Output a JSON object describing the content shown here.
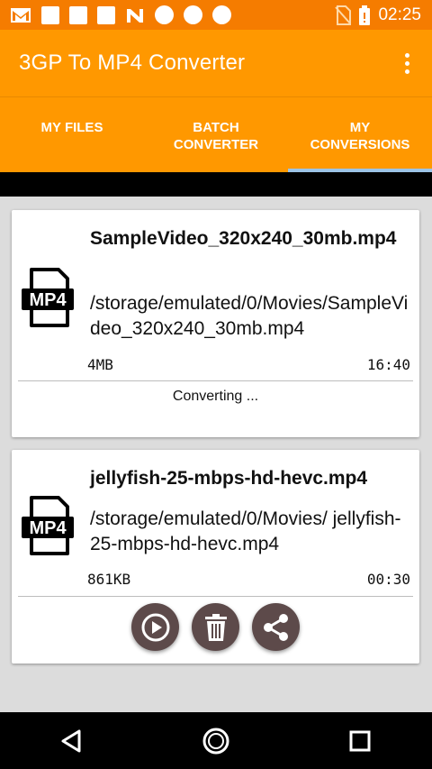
{
  "status_bar": {
    "time": "02:25",
    "icons": [
      "gmail-icon",
      "notification-icon",
      "notification-icon",
      "notification-icon",
      "nfc-icon",
      "circle-icon",
      "circle-icon",
      "circle-icon",
      "no-sim-icon",
      "battery-icon"
    ]
  },
  "app_bar": {
    "title": "3GP To MP4 Converter",
    "menu_icon": "more-vert-icon"
  },
  "tabs": [
    {
      "line1": "MY FILES",
      "line2": ""
    },
    {
      "line1": "BATCH",
      "line2": "CONVERTER"
    },
    {
      "line1": "MY",
      "line2": "CONVERSIONS"
    }
  ],
  "active_tab": 2,
  "conversions": [
    {
      "icon_label": "MP4",
      "name": "SampleVideo_320x240_30mb.mp4",
      "path": "/storage/emulated/0/Movies/SampleVideo_320x240_30mb.mp4",
      "size": "4MB",
      "duration": "16:40",
      "status": "Converting ..."
    },
    {
      "icon_label": "MP4",
      "name": "jellyfish-25-mbps-hd-hevc.mp4",
      "path": "/storage/emulated/0/Movies/ jellyfish-25-mbps-hd-hevc.mp4",
      "size": "861KB",
      "duration": "00:30",
      "actions": [
        "play-icon",
        "delete-icon",
        "share-icon"
      ]
    }
  ],
  "colors": {
    "primary": "#ff9800",
    "primary_dark": "#f57c00",
    "indicator": "#9cc3e6",
    "action_button": "#5d4a4a"
  }
}
